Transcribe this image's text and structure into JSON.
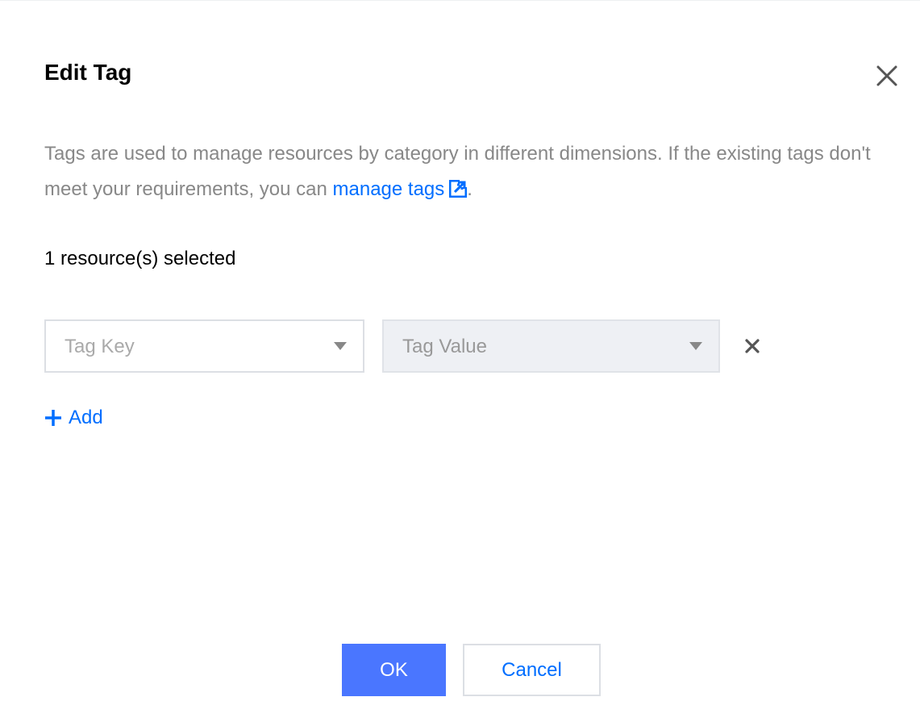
{
  "dialog": {
    "title": "Edit Tag",
    "description_prefix": "Tags are used to manage resources by category in different dimensions. If the existing tags don't meet your requirements, you can ",
    "manage_tags_link": "manage tags",
    "description_suffix": ".",
    "selected_count": "1 resource(s) selected",
    "tag_key_placeholder": "Tag Key",
    "tag_value_placeholder": "Tag Value",
    "add_label": "Add",
    "ok_label": "OK",
    "cancel_label": "Cancel"
  },
  "icons": {
    "close": "close-icon",
    "external_link": "external-link-icon",
    "caret": "chevron-down-icon",
    "remove": "remove-icon",
    "add": "plus-icon"
  },
  "colors": {
    "accent": "#006eff",
    "primary_button": "#4a76ff",
    "muted_text": "#888888",
    "disabled_field": "#eef0f4"
  }
}
